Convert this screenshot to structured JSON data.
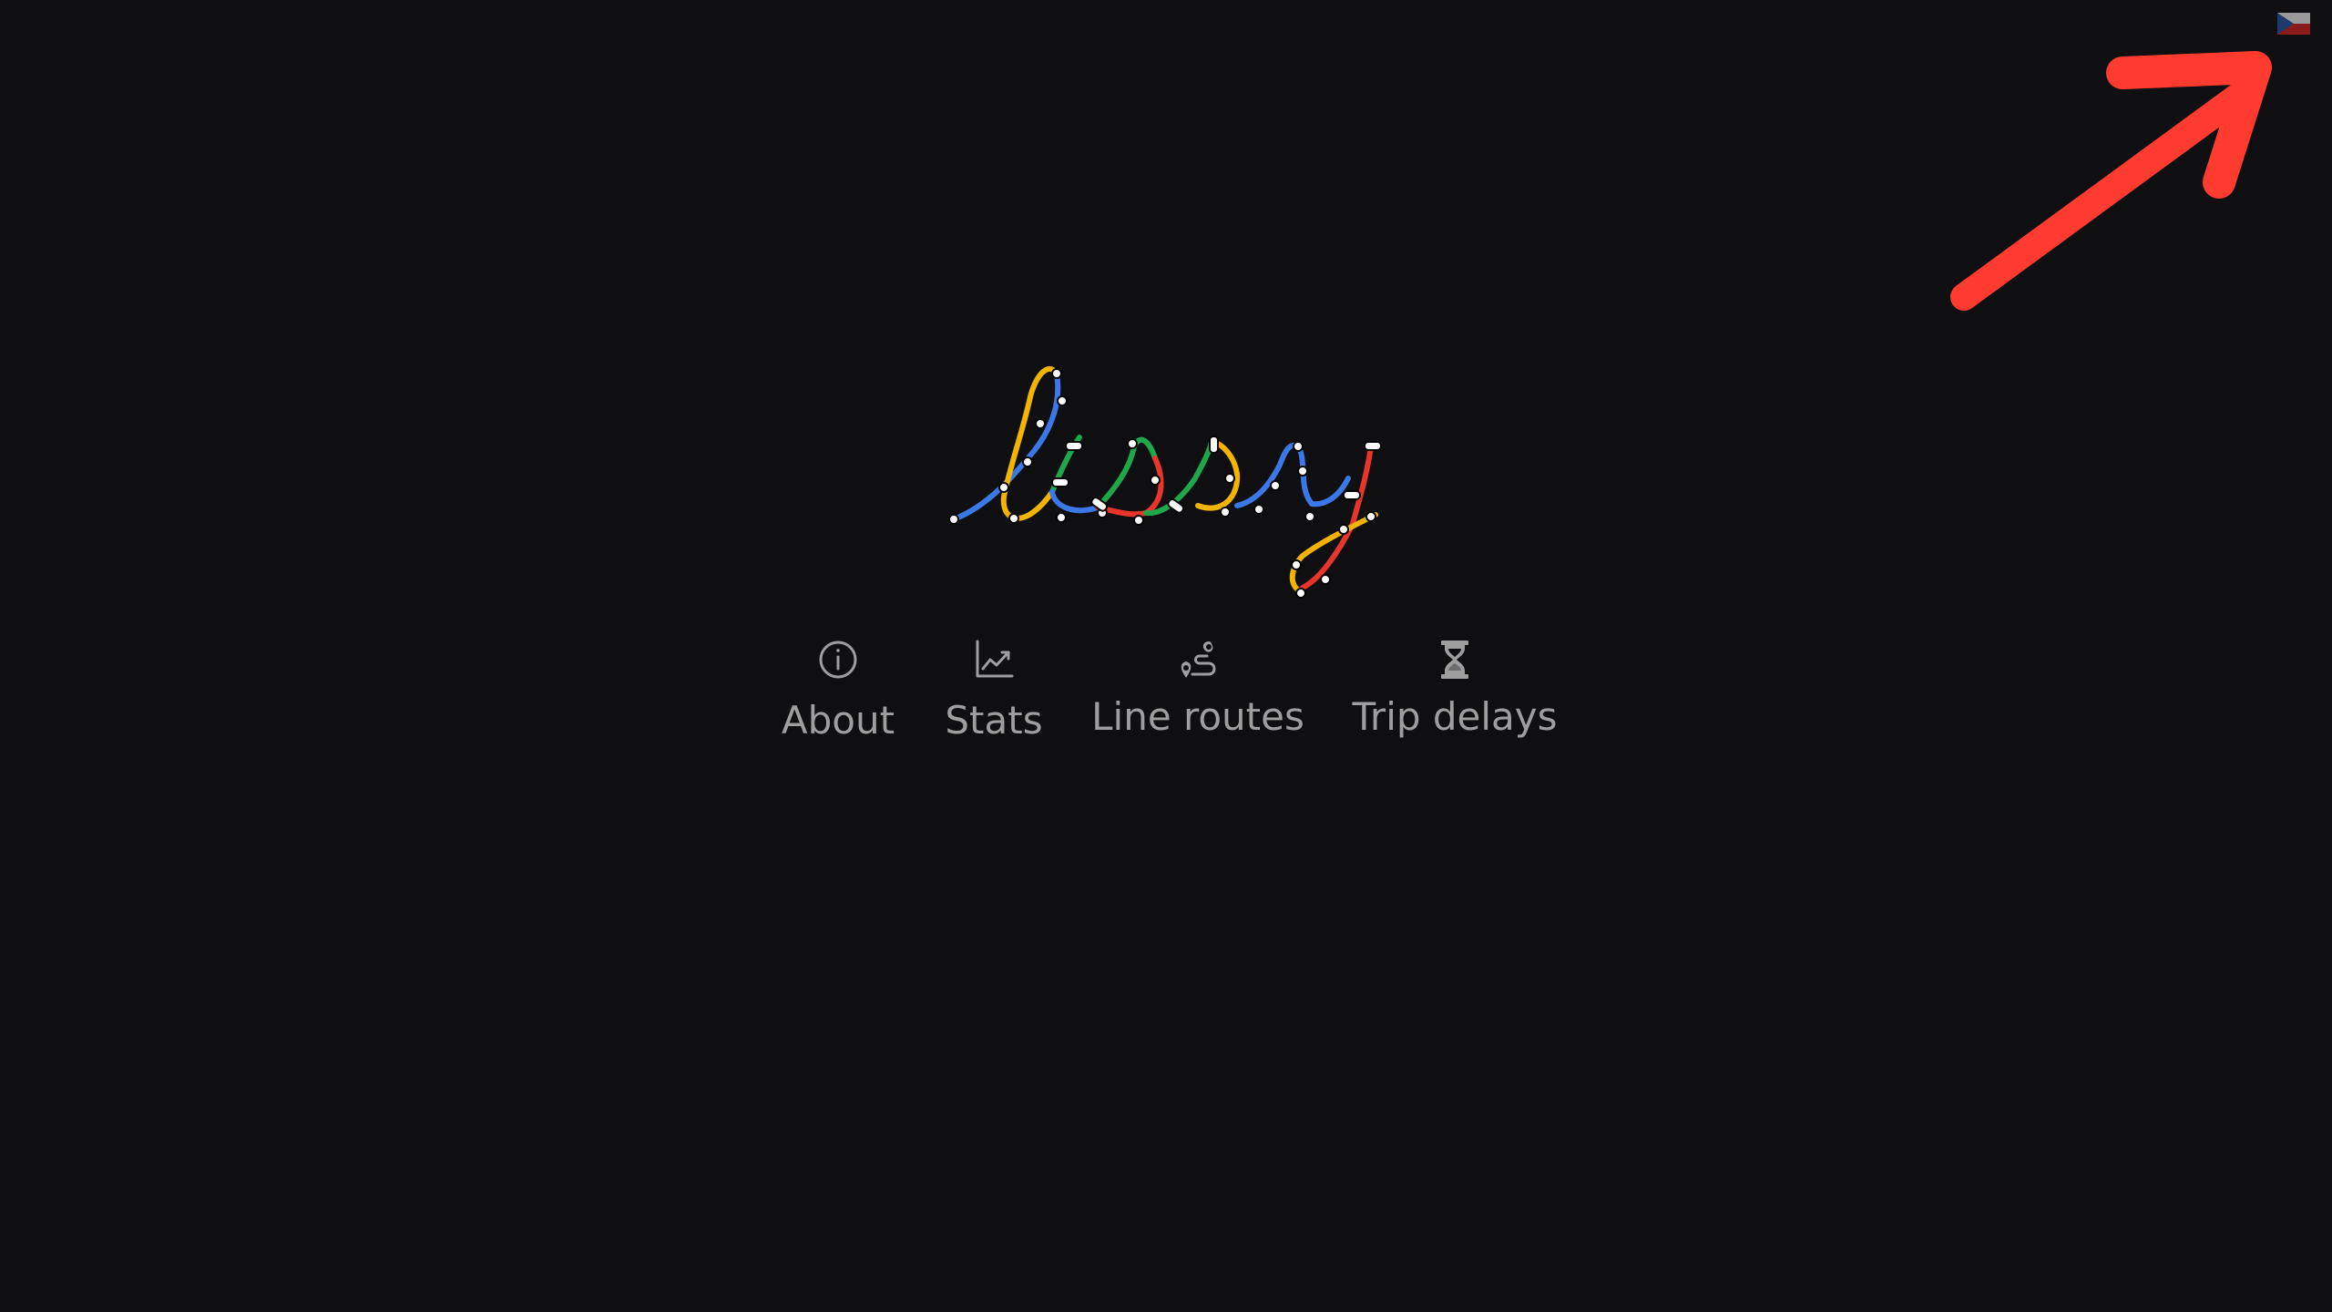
{
  "header": {
    "language_flag_icon": "czech-flag-icon"
  },
  "logo": {
    "text": "lissy",
    "colors": {
      "blue": "#3b78e7",
      "yellow": "#f2b400",
      "green": "#1fa84a",
      "red": "#e8352b",
      "stop": "#ffffff"
    }
  },
  "annotation": {
    "arrow_color": "#ff3b30",
    "arrow_icon": "pointer-arrow"
  },
  "nav": {
    "items": [
      {
        "label": "About",
        "icon": "info-icon"
      },
      {
        "label": "Stats",
        "icon": "chart-icon"
      },
      {
        "label": "Line routes",
        "icon": "route-icon"
      },
      {
        "label": "Trip delays",
        "icon": "hourglass-icon"
      }
    ],
    "text_color": "#9e9e9e"
  },
  "colors": {
    "background": "#0f0f11"
  }
}
